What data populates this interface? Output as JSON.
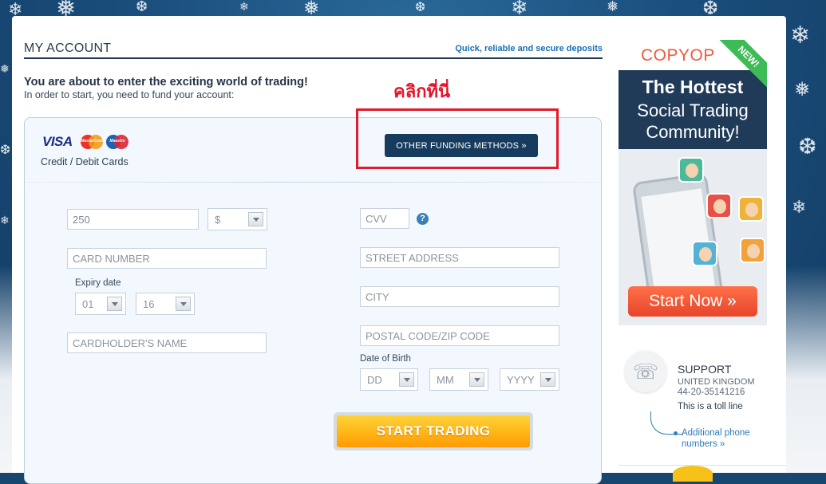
{
  "header": {
    "title": "MY ACCOUNT",
    "tagline": "Quick, reliable and secure deposits"
  },
  "intro": {
    "heading": "You are about to enter the exciting world of trading!",
    "sub": "In order to start, you need to fund your account:"
  },
  "annotation": {
    "click_here": "คลิกที่นี่",
    "highlight_color": "#e01b2b"
  },
  "payment": {
    "card_logos": [
      "VISA",
      "MasterCard",
      "Maestro"
    ],
    "cards_label": "Credit / Debit Cards",
    "other_funding_label": "OTHER FUNDING METHODS »"
  },
  "form": {
    "amount_value": "250",
    "currency_value": "$",
    "card_number_placeholder": "CARD NUMBER",
    "expiry_label": "Expiry date",
    "expiry_month": "01",
    "expiry_year": "16",
    "cardholder_placeholder": "CARDHOLDER'S NAME",
    "cvv_placeholder": "CVV",
    "cvv_help": "?",
    "street_placeholder": "STREET ADDRESS",
    "city_placeholder": "CITY",
    "postal_placeholder": "POSTAL CODE/ZIP CODE",
    "dob_label": "Date of Birth",
    "dob_day": "DD",
    "dob_month": "MM",
    "dob_year": "YYYY",
    "submit_label": "START TRADING"
  },
  "ad": {
    "brand": "COPYOP",
    "ribbon": "NEW!",
    "line1": "The Hottest",
    "line2": "Social Trading",
    "line3": "Community!",
    "cta": "Start Now »",
    "accent_color": "#ef5a3c",
    "ribbon_color": "#3dbb55"
  },
  "support": {
    "title": "SUPPORT",
    "country": "UNITED KINGDOM",
    "phone": "44-20-35141216",
    "note": "This is a toll line",
    "more_link": "Additional phone numbers »",
    "icon": "phone-icon"
  },
  "colors": {
    "primary_button": "#173b5e",
    "cta_orange": "#ffb819",
    "link_blue": "#1b6fb3"
  }
}
